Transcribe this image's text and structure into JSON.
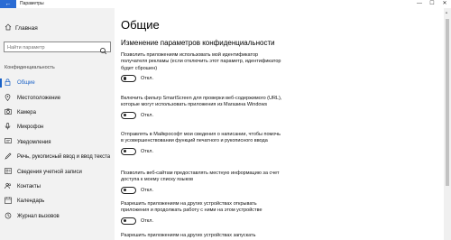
{
  "window": {
    "title": "Параметры",
    "back_glyph": "←",
    "minimize": "—",
    "maximize": "☐",
    "close": "✕"
  },
  "sidebar": {
    "home_label": "Главная",
    "search_placeholder": "Найти параметр",
    "section_header": "Конфиденциальность",
    "items": [
      {
        "label": "Общие",
        "icon": "lock-icon",
        "active": true
      },
      {
        "label": "Местоположение",
        "icon": "location-icon"
      },
      {
        "label": "Камера",
        "icon": "camera-icon"
      },
      {
        "label": "Микрофон",
        "icon": "microphone-icon"
      },
      {
        "label": "Уведомления",
        "icon": "notifications-icon"
      },
      {
        "label": "Речь, рукописный ввод и ввод текста",
        "icon": "speech-icon"
      },
      {
        "label": "Сведения учетной записи",
        "icon": "account-icon"
      },
      {
        "label": "Контакты",
        "icon": "contacts-icon"
      },
      {
        "label": "Календарь",
        "icon": "calendar-icon"
      },
      {
        "label": "Журнал вызовов",
        "icon": "call-history-icon"
      }
    ]
  },
  "main": {
    "title": "Общие",
    "section_title": "Изменение параметров конфиденциальности",
    "options": [
      {
        "text": "Позволить приложениям использовать мой идентификатор получателя рекламы (если отключить этот параметр, идентификатор будет сброшен)",
        "state": "Откл."
      },
      {
        "text": "Включить фильтр SmartScreen для проверки веб-содержимого (URL), которые могут использовать приложения из Магазина Windows",
        "state": "Откл."
      },
      {
        "text": "Отправлять в Майкрософт мои сведения о написании, чтобы помочь в усовершенствовании функций печатного и рукописного ввода",
        "state": "Откл."
      },
      {
        "text": "Позволить веб-сайтам предоставлять местную информацию за счет доступа к моему списку языков",
        "state": "Откл."
      },
      {
        "text": "Разрешить приложениям на других устройствах открывать приложения и продолжать работу с ними на этом устройстве",
        "state": "Откл."
      },
      {
        "text": "Разрешить приложениям на других устройствах запускать",
        "state": ""
      }
    ]
  },
  "colors": {
    "accent": "#1a62c7",
    "sidebar_bg": "#f2f2f2",
    "back_button": "#2b6cd4"
  }
}
